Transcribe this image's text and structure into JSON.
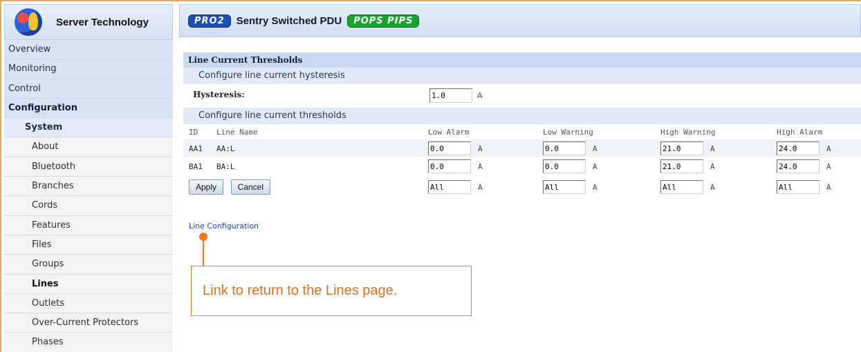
{
  "brand": {
    "name": "Server Technology"
  },
  "header": {
    "pro_badge": "PRO2",
    "title": "Sentry Switched PDU",
    "pops_badge": "POPS PIPS"
  },
  "sidebar": {
    "items": [
      {
        "label": "Overview"
      },
      {
        "label": "Monitoring"
      },
      {
        "label": "Control"
      },
      {
        "label": "Configuration"
      },
      {
        "label": "System"
      },
      {
        "label": "About"
      },
      {
        "label": "Bluetooth"
      },
      {
        "label": "Branches"
      },
      {
        "label": "Cords"
      },
      {
        "label": "Features"
      },
      {
        "label": "Files"
      },
      {
        "label": "Groups"
      },
      {
        "label": "Lines"
      },
      {
        "label": "Outlets"
      },
      {
        "label": "Over-Current Protectors"
      },
      {
        "label": "Phases"
      }
    ]
  },
  "main": {
    "section_title": "Line Current Thresholds",
    "hysteresis_heading": "Configure line current hysteresis",
    "hysteresis_label": "Hysteresis:",
    "hysteresis_value": "1.0",
    "hysteresis_unit": "A",
    "thresholds_heading": "Configure line current thresholds",
    "columns": [
      "ID",
      "Line Name",
      "Low Alarm",
      "Low Warning",
      "High Warning",
      "High Alarm"
    ],
    "rows": [
      {
        "id": "AA1",
        "name": "AA:L",
        "low_alarm": "0.0",
        "low_warning": "0.0",
        "high_warning": "21.0",
        "high_alarm": "24.0"
      },
      {
        "id": "BA1",
        "name": "BA:L",
        "low_alarm": "0.0",
        "low_warning": "0.0",
        "high_warning": "21.0",
        "high_alarm": "24.0"
      }
    ],
    "all_values": {
      "low_alarm": "All",
      "low_warning": "All",
      "high_warning": "All",
      "high_alarm": "All"
    },
    "unit": "A",
    "apply_label": "Apply",
    "cancel_label": "Cancel",
    "line_config_link": "Line Configuration"
  },
  "callout": {
    "text": "Link to return to the Lines page."
  }
}
